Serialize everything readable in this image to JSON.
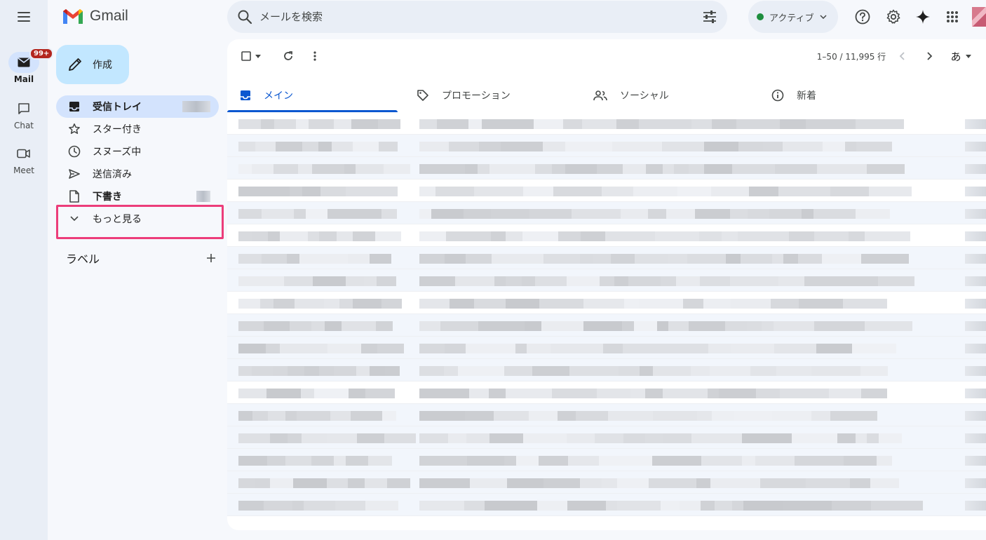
{
  "app": {
    "name": "Gmail"
  },
  "rail": {
    "items": [
      {
        "label": "Mail",
        "badge": "99+"
      },
      {
        "label": "Chat"
      },
      {
        "label": "Meet"
      }
    ]
  },
  "search": {
    "placeholder": "メールを検索"
  },
  "header": {
    "status_label": "アクティブ",
    "input_tool_label": "あ"
  },
  "compose": {
    "label": "作成"
  },
  "nav": {
    "items": [
      {
        "label": "受信トレイ"
      },
      {
        "label": "スター付き"
      },
      {
        "label": "スヌーズ中"
      },
      {
        "label": "送信済み"
      },
      {
        "label": "下書き"
      },
      {
        "label": "もっと見る"
      }
    ]
  },
  "labels": {
    "title": "ラベル"
  },
  "toolbar": {
    "pagination": "1–50 / 11,995 行"
  },
  "tabs": [
    {
      "label": "メイン"
    },
    {
      "label": "プロモーション"
    },
    {
      "label": "ソーシャル"
    },
    {
      "label": "新着"
    }
  ],
  "colors": {
    "accent": "#0b57d0",
    "compose_bg": "#c2e7ff",
    "active_nav_bg": "#d3e3fd",
    "highlight": "#ec3d7a",
    "badge": "#b3261e",
    "status_dot": "#1e8e3e"
  },
  "email_row_count": 18
}
